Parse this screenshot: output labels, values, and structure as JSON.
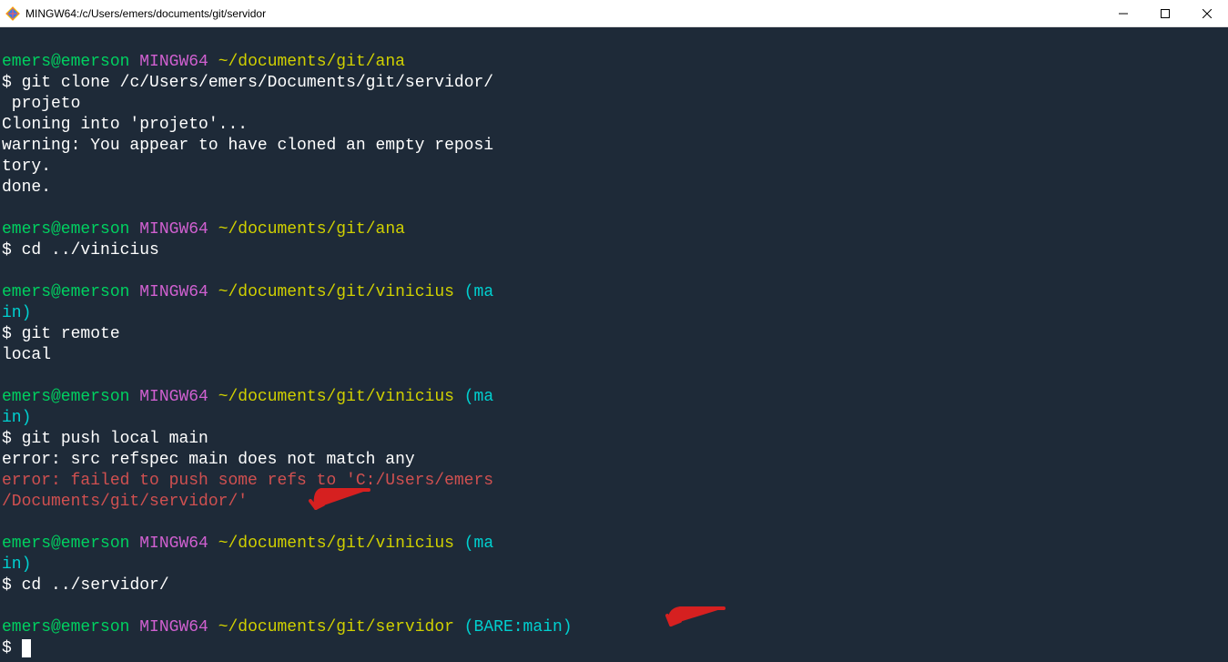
{
  "window": {
    "title": "MINGW64:/c/Users/emers/documents/git/servidor"
  },
  "colors": {
    "terminal_bg": "#1e2a38",
    "green": "#00d060",
    "magenta": "#d060d0",
    "yellow": "#d0d000",
    "cyan": "#00d0d0",
    "red_error": "#d05050",
    "annotation_red": "#d62020"
  },
  "blocks": [
    {
      "prompt": {
        "user": "emers@emerson",
        "env": "MINGW64",
        "path": "~/documents/git/ana",
        "branch": ""
      },
      "command": "git clone /c/Users/emers/Documents/git/servidor/\n projeto",
      "output": "Cloning into 'projeto'...\nwarning: You appear to have cloned an empty reposi\ntory.\ndone."
    },
    {
      "prompt": {
        "user": "emers@emerson",
        "env": "MINGW64",
        "path": "~/documents/git/ana",
        "branch": ""
      },
      "command": "cd ../vinicius",
      "output": ""
    },
    {
      "prompt": {
        "user": "emers@emerson",
        "env": "MINGW64",
        "path": "~/documents/git/vinicius",
        "branch": "(ma\nin)"
      },
      "command": "git remote",
      "output": "local"
    },
    {
      "prompt": {
        "user": "emers@emerson",
        "env": "MINGW64",
        "path": "~/documents/git/vinicius",
        "branch": "(ma\nin)"
      },
      "command": "git push local main",
      "output": "error: src refspec main does not match any",
      "error": "error: failed to push some refs to 'C:/Users/emers\n/Documents/git/servidor/'"
    },
    {
      "prompt": {
        "user": "emers@emerson",
        "env": "MINGW64",
        "path": "~/documents/git/vinicius",
        "branch": "(ma\nin)"
      },
      "command": "cd ../servidor/",
      "output": ""
    },
    {
      "prompt": {
        "user": "emers@emerson",
        "env": "MINGW64",
        "path": "~/documents/git/servidor",
        "branch": "(BARE:main)"
      },
      "command": "",
      "output": ""
    }
  ],
  "prompt_symbol": "$"
}
